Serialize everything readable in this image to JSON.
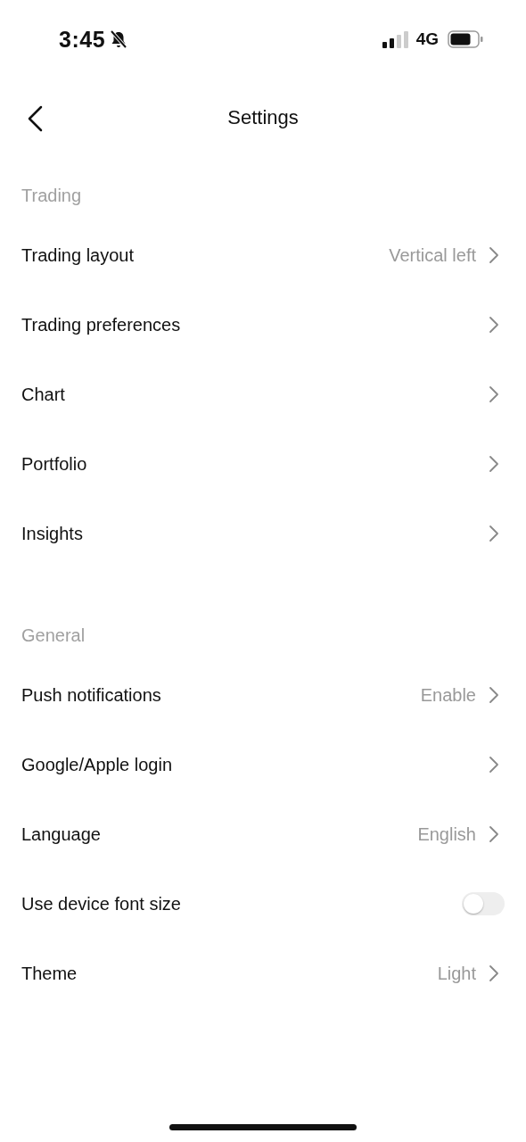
{
  "status_bar": {
    "time": "3:45",
    "network": "4G"
  },
  "header": {
    "title": "Settings"
  },
  "sections": [
    {
      "title": "Trading",
      "items": [
        {
          "kind": "link",
          "label": "Trading layout",
          "value": "Vertical left"
        },
        {
          "kind": "link",
          "label": "Trading preferences"
        },
        {
          "kind": "link",
          "label": "Chart"
        },
        {
          "kind": "link",
          "label": "Portfolio"
        },
        {
          "kind": "link",
          "label": "Insights"
        }
      ]
    },
    {
      "title": "General",
      "items": [
        {
          "kind": "link",
          "label": "Push notifications",
          "value": "Enable"
        },
        {
          "kind": "link",
          "label": "Google/Apple login"
        },
        {
          "kind": "link",
          "label": "Language",
          "value": "English"
        },
        {
          "kind": "toggle",
          "label": "Use device font size",
          "on": false
        },
        {
          "kind": "link",
          "label": "Theme",
          "value": "Light"
        }
      ]
    }
  ]
}
